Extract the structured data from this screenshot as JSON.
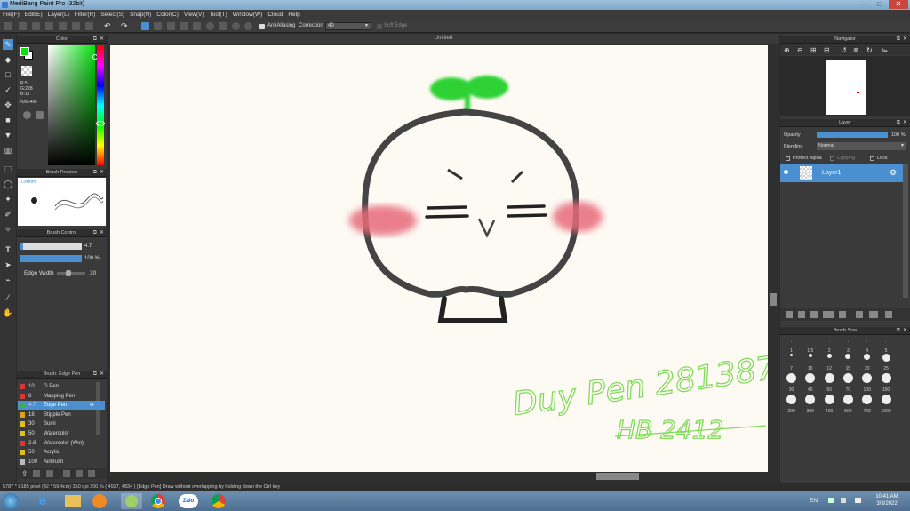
{
  "window": {
    "title": "MediBang Paint Pro (32bit)",
    "minimize": "–",
    "maximize": "□",
    "close": "✕"
  },
  "menu": [
    "File(F)",
    "Edit(E)",
    "Layer(L)",
    "Filter(R)",
    "Select(S)",
    "Snap(N)",
    "Color(C)",
    "View(V)",
    "Tool(T)",
    "Window(W)",
    "Cloud",
    "Help"
  ],
  "toolbar": {
    "antialiasing": "AntiAliasing",
    "correction_label": "Correction",
    "correction_value": "40",
    "soft_edge": "Soft Edge"
  },
  "canvas": {
    "tab_title": "Untitled"
  },
  "color_panel": {
    "title": "Color",
    "r": "R:5",
    "g": "G:228",
    "b": "B:15",
    "hex": "#05E40F",
    "accent": "#05e40f"
  },
  "brush_preview": {
    "title": "Brush Preview",
    "size": "0.34mm"
  },
  "brush_control": {
    "title": "Brush Control",
    "size_value": "4.7",
    "opacity_value": "100 %",
    "edge_width_label": "Edge Width",
    "edge_width_value": "30",
    "opacity_fill": 1.0,
    "size_fill": 0.05,
    "edge_fill": 0.3
  },
  "brush_list": {
    "title": "Brush: Edge Pen",
    "items": [
      {
        "size": "10",
        "name": "G Pen",
        "color": "#d23a3a"
      },
      {
        "size": "8",
        "name": "Mapping Pen",
        "color": "#d23a3a"
      },
      {
        "size": "4.7",
        "name": "Edge Pen",
        "color": "#3cb043",
        "selected": true
      },
      {
        "size": "18",
        "name": "Stipple Pen",
        "color": "#e0a020"
      },
      {
        "size": "30",
        "name": "Sumi",
        "color": "#e0c020"
      },
      {
        "size": "50",
        "name": "Watercolor",
        "color": "#e0c020"
      },
      {
        "size": "2.8",
        "name": "Watercolor (Wet)",
        "color": "#d23a3a"
      },
      {
        "size": "50",
        "name": "Acrylic",
        "color": "#e0c020"
      },
      {
        "size": "100",
        "name": "Airbrush",
        "color": "#bbbbbb"
      }
    ]
  },
  "navigator": {
    "title": "Navigator"
  },
  "layer_panel": {
    "title": "Layer",
    "opacity_label": "Opacity",
    "opacity_value": "100 %",
    "opacity_fill": 1.0,
    "blending_label": "Blending",
    "blending_value": "Normal",
    "protect_alpha": "Protect Alpha",
    "clipping": "Clipping",
    "lock": "Lock",
    "layers": [
      {
        "name": "Layer1"
      }
    ]
  },
  "brush_size": {
    "title": "Brush Size",
    "rows": [
      [
        "·",
        "·",
        "·",
        "·",
        "·",
        "·"
      ],
      [
        "1",
        "1.5",
        "2",
        "3",
        "4",
        "5"
      ],
      [
        "7",
        "10",
        "12",
        "15",
        "20",
        "25"
      ],
      [
        "30",
        "40",
        "50",
        "70",
        "100",
        "150"
      ],
      [
        "200",
        "300",
        "400",
        "500",
        "700",
        "1000"
      ]
    ]
  },
  "statusbar": {
    "text": "5787 * 8185 pixel  (42 * 59.4cm)  350 dpi  300 %  ( 4927, 4834 )  [Edge Pen] Draw without overlapping by holding down the Ctrl key"
  },
  "drawing": {
    "signature_line1": "Duy Pen 281387",
    "signature_line2": "HB 2412",
    "signature_color": "#7ed957"
  },
  "taskbar": {
    "lang": "EN",
    "time": "10:41 AM",
    "date": "3/3/2022",
    "zalo": "Zalo"
  }
}
